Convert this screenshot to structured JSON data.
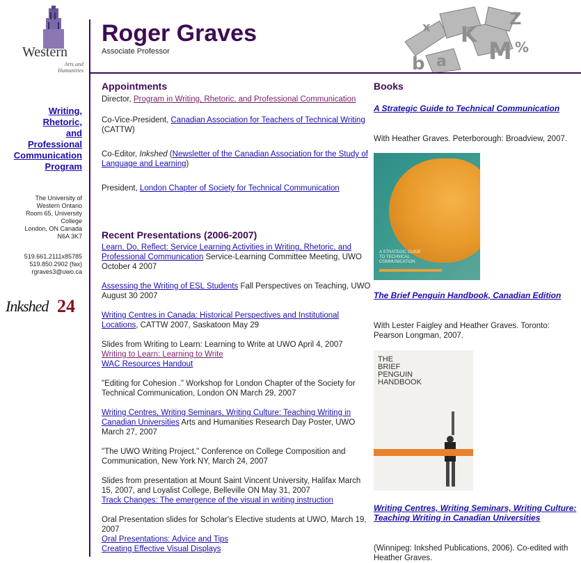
{
  "header": {
    "name": "Roger Graves",
    "subtitle": "Associate Professor"
  },
  "sidebar": {
    "logo_word": "Western",
    "logo_sub1": "Arts and",
    "logo_sub2": "Humanities",
    "program_lines": [
      "Writing,",
      "Rhetoric,",
      "and",
      "Professional",
      "Communication",
      "Program"
    ],
    "address_lines": [
      "The University of",
      "Western Ontario",
      "Room 65, University",
      "College",
      "London, ON Canada",
      "N6A 3K7"
    ],
    "contact_lines": [
      "519.661.2111x85785",
      "519.850.2902 (fax)",
      "rgraves3@uwo.ca"
    ],
    "inkshed_word": "Inkshed",
    "inkshed_num": "24"
  },
  "appointments": {
    "heading": "Appointments",
    "items": [
      {
        "pre": "Director, ",
        "link": "Program in Writing, Rhetoric, and Professional Communication",
        "post": ""
      },
      {
        "pre": "Co-Vice-President, ",
        "link": "Canadian Association for Teachers of Technical Writing",
        "post": " (CATTW)"
      },
      {
        "pre": "Co-Editor, ",
        "italic": "Inkshed",
        "mid": " (",
        "link": "Newsletter of the Canadian Association for the Study of Language and Learning",
        "post": ")"
      },
      {
        "pre": "President, ",
        "link": "London Chapter of Society for Technical Communication",
        "post": ""
      }
    ]
  },
  "presentations": {
    "heading": "Recent Presentations (2006-2007)",
    "p1_link": "Learn, Do, Reflect: Service Learning Activities in Writing, Rhetoric, and Professional Communication",
    "p1_text": " Service-Learning Committee Meeting, UWO October 4 2007",
    "p2_link": "Assessing the Writing of ESL Students",
    "p2_text": " Fall Perspectives on Teaching, UWO August 30 2007",
    "p3_link": "Writing Centres in Canada: Historical Perspectives and Institutional Locations",
    "p3_text": ", CATTW 2007, Saskatoon May 29",
    "p4_text": "Slides from Writing to Learn: Learning to Write at UWO April 4, 2007",
    "p4_link1": "Writing to Learn: Learning to Write",
    "p4_link2": "WAC Resources Handout",
    "p5_text": "\"Editing for Cohesion .\" Workshop for London Chapter of the Society for Technical Communication, London ON March 29, 2007",
    "p6_link": "Writing Centres, Writing Seminars, Writing Culture: Teaching Writing in Canadian Universities",
    "p6_text": " Arts and Humanities Research Day Poster, UWO March 27, 2007",
    "p7_text": "\"The UWO Writing Project.\" Conference on College Composition and Communication, New York NY, March 24, 2007",
    "p8_text": "Slides from presentation at Mount Saint Vincent University, Halifax March 15, 2007, and Loyalist College, Belleville ON May 31, 2007",
    "p8_link": "Track Changes: The emergence of the visual in writing instruction",
    "p9_text": "Oral Presentation slides for Scholar's Elective students at UWO, March 19, 2007",
    "p9_link1": "Oral Presentations: Advice and Tips",
    "p9_link2": "Creating Effective Visual Displays"
  },
  "books": {
    "heading": "Books",
    "b1_title": "A Strategic Guide to Technical Communication",
    "b1_desc": "With Heather Graves. Peterborough: Broadview, 2007.",
    "b1_cover_text": "A STRATEGIC GUIDE TO TECHNICAL COMMUNICATION",
    "b2_title": "The Brief Penguin Handbook, Canadian Edition",
    "b2_desc": "With Lester Faigley and Heather Graves. Toronto: Pearson Longman, 2007.",
    "b2_cover_lines": [
      "THE",
      "BRIEF",
      "PENGUIN",
      "HANDBOOK"
    ],
    "b3_title": "Writing Centres, Writing Seminars, Writing Culture: Teaching Writing in Canadian Universities",
    "b3_desc": "(Winnipeg: Inkshed Publications, 2006). Co-edited with Heather Graves."
  },
  "colors": {
    "heading": "#3d0b54",
    "link": "#1a0dab",
    "visited": "#7a1f6a",
    "inkshed_num": "#8a0d18"
  }
}
